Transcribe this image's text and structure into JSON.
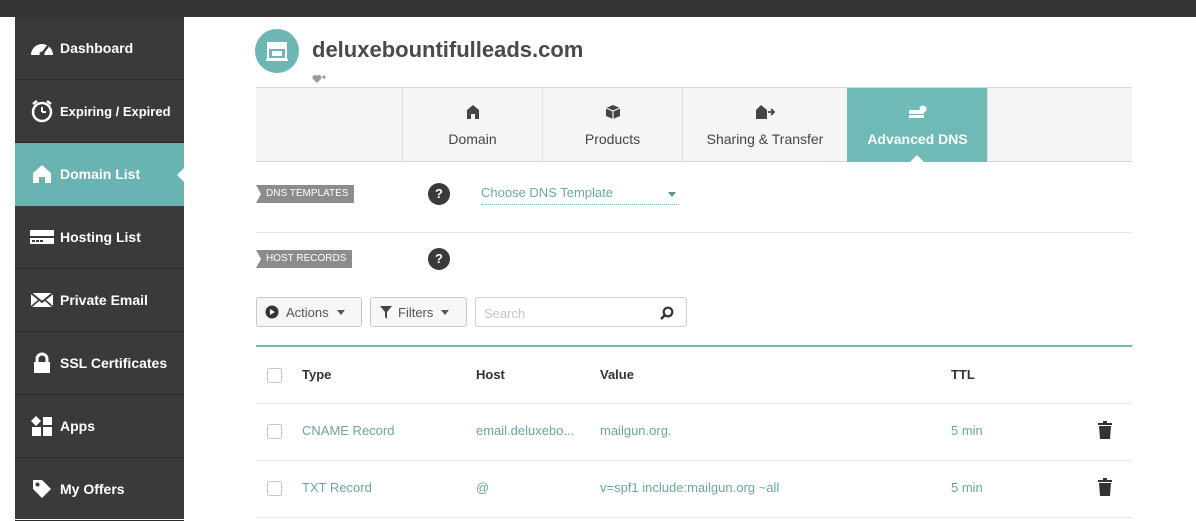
{
  "sidebar": {
    "items": [
      {
        "label": "Dashboard",
        "icon": "speedometer-icon"
      },
      {
        "label": "Expiring / Expired",
        "icon": "clock-icon"
      },
      {
        "label": "Domain List",
        "icon": "house-icon",
        "active": true
      },
      {
        "label": "Hosting List",
        "icon": "server-icon"
      },
      {
        "label": "Private Email",
        "icon": "envelope-icon"
      },
      {
        "label": "SSL Certificates",
        "icon": "lock-icon"
      },
      {
        "label": "Apps",
        "icon": "apps-icon"
      },
      {
        "label": "My Offers",
        "icon": "tag-icon"
      }
    ]
  },
  "header": {
    "domain": "deluxebountifulleads.com"
  },
  "tabs": [
    {
      "label": "Domain",
      "icon": "house-icon"
    },
    {
      "label": "Products",
      "icon": "box-icon"
    },
    {
      "label": "Sharing & Transfer",
      "icon": "transfer-icon"
    },
    {
      "label": "Advanced DNS",
      "icon": "dns-server-icon",
      "active": true
    }
  ],
  "dns_templates": {
    "tag": "DNS TEMPLATES",
    "help": "?",
    "select_value": "Choose DNS Template"
  },
  "host_records": {
    "tag": "HOST RECORDS",
    "help": "?"
  },
  "toolbar": {
    "actions_label": "Actions",
    "filters_label": "Filters",
    "search_placeholder": "Search"
  },
  "table": {
    "headers": {
      "type": "Type",
      "host": "Host",
      "value": "Value",
      "ttl": "TTL"
    },
    "rows": [
      {
        "type": "CNAME Record",
        "host": "email.deluxebo...",
        "value": "mailgun.org.",
        "ttl": "5 min"
      },
      {
        "type": "TXT Record",
        "host": "@",
        "value": "v=spf1 include:mailgun.org ~all",
        "ttl": "5 min"
      }
    ]
  },
  "colors": {
    "accent": "#6fb9b6",
    "sidebar_bg": "#3a3a3a",
    "link_text": "#6aa6a4"
  }
}
